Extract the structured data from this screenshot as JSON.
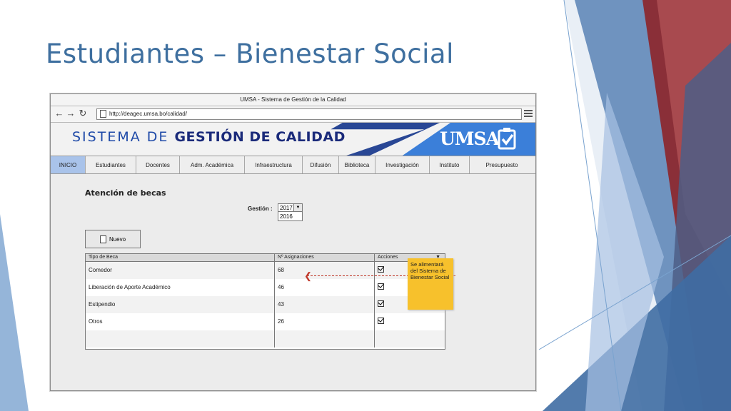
{
  "slide": {
    "title": "Estudiantes – Bienestar Social"
  },
  "window": {
    "title": "UMSA - Sistema de Gestión de la Calidad",
    "url": "http://deagec.umsa.bo/calidad/"
  },
  "banner": {
    "text_light": "SISTEMA DE ",
    "text_bold": "GESTIÓN DE CALIDAD",
    "logo": "UMSA"
  },
  "menu": [
    "INICIO",
    "Estudiantes",
    "Docentes",
    "Adm. Académica",
    "Infraestructura",
    "Difusión",
    "Biblioteca",
    "Investigación",
    "Instituto",
    "Presupuesto"
  ],
  "page": {
    "heading": "Atención de becas",
    "gestion_label": "Gestión :",
    "gestion_selected": "2017",
    "gestion_option": "2016",
    "new_button": "Nuevo"
  },
  "table": {
    "headers": [
      "Tipo de Beca",
      "Nº Asignaciones",
      "Acciones"
    ],
    "rows": [
      [
        "Comedor",
        "68"
      ],
      [
        "Liberación de Aporte Académico",
        "46"
      ],
      [
        "Estipendio",
        "43"
      ],
      [
        "Otros",
        "26"
      ]
    ]
  },
  "note": {
    "text": "Se alimentará del Sistema de Bienestar Social"
  },
  "colors": {
    "accent": "#3b7fd9",
    "menu_active": "#a9c3ea",
    "note": "#f7c12c",
    "arrow": "#c0392b"
  }
}
